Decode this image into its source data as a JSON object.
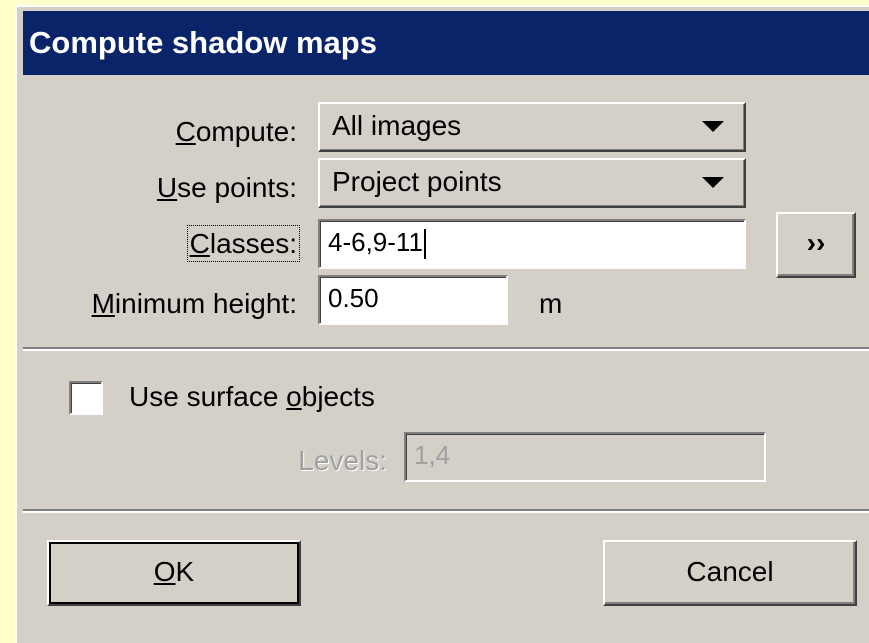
{
  "dialog": {
    "title": "Compute shadow maps"
  },
  "compute": {
    "label_accel": "C",
    "label_rest": "ompute:",
    "value": "All images"
  },
  "use_points": {
    "label_accel": "U",
    "label_rest": "se points:",
    "value": "Project points"
  },
  "classes": {
    "label_accel": "C",
    "label_rest": "lasses:",
    "value": "4-6,9-11",
    "more_label": "››"
  },
  "min_height": {
    "label_accel": "M",
    "label_rest": "inimum height:",
    "value": "0.50",
    "unit": "m"
  },
  "surface": {
    "checkbox_pre": "Use surface ",
    "checkbox_accel": "o",
    "checkbox_post": "bjects",
    "checked": false
  },
  "levels": {
    "label": "Levels:",
    "value": "1,4"
  },
  "buttons": {
    "ok_accel": "O",
    "ok_rest": "K",
    "cancel": "Cancel"
  }
}
